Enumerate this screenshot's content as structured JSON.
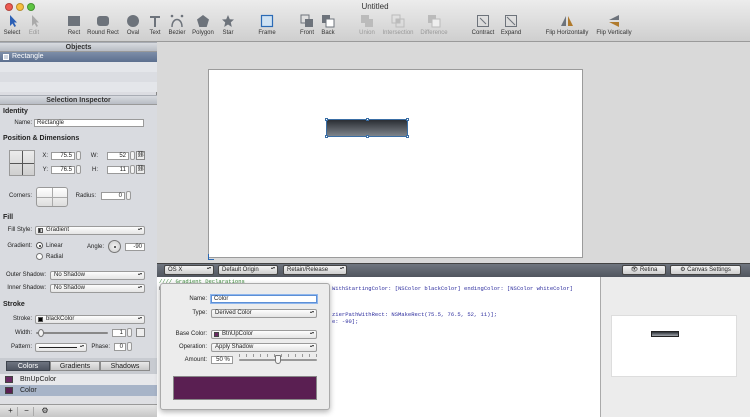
{
  "window": {
    "title": "Untitled"
  },
  "toolbar": [
    {
      "label": "Select",
      "icon": "arrow-cursor-icon",
      "enabled": true
    },
    {
      "label": "Edit",
      "icon": "edit-cursor-icon",
      "enabled": false
    },
    {
      "label": "Rect",
      "icon": "rect-icon",
      "enabled": true
    },
    {
      "label": "Round Rect",
      "icon": "round-rect-icon",
      "enabled": true
    },
    {
      "label": "Oval",
      "icon": "oval-icon",
      "enabled": true
    },
    {
      "label": "Text",
      "icon": "text-icon",
      "enabled": true
    },
    {
      "label": "Bezier",
      "icon": "bezier-icon",
      "enabled": true
    },
    {
      "label": "Polygon",
      "icon": "polygon-icon",
      "enabled": true
    },
    {
      "label": "Star",
      "icon": "star-icon",
      "enabled": true
    },
    {
      "label": "Frame",
      "icon": "frame-icon",
      "enabled": true
    },
    {
      "label": "Front",
      "icon": "front-icon",
      "enabled": true
    },
    {
      "label": "Back",
      "icon": "back-icon",
      "enabled": true
    },
    {
      "label": "Union",
      "icon": "union-icon",
      "enabled": false
    },
    {
      "label": "Intersection",
      "icon": "intersection-icon",
      "enabled": false
    },
    {
      "label": "Difference",
      "icon": "difference-icon",
      "enabled": false
    },
    {
      "label": "Contract",
      "icon": "contract-icon",
      "enabled": true
    },
    {
      "label": "Expand",
      "icon": "expand-icon",
      "enabled": true
    },
    {
      "label": "Flip Horizontally",
      "icon": "flip-horizontal-icon",
      "enabled": true
    },
    {
      "label": "Flip Vertically",
      "icon": "flip-vertical-icon",
      "enabled": true
    }
  ],
  "objects": {
    "header": "Objects",
    "items": [
      "Rectangle"
    ]
  },
  "inspector": {
    "header": "Selection Inspector",
    "identity": {
      "title": "Identity",
      "name_label": "Name:",
      "name_value": "Rectangle"
    },
    "position": {
      "title": "Position & Dimensions",
      "x_label": "X:",
      "x": "75.5",
      "y_label": "Y:",
      "y": "76.5",
      "w_label": "W:",
      "w": "52",
      "h_label": "H:",
      "h": "11"
    },
    "corners": {
      "label": "Corners:",
      "radius_label": "Radius:",
      "radius": "0"
    },
    "fill": {
      "title": "Fill",
      "style_label": "Fill Style:",
      "style": "Gradient",
      "gradient_label": "Gradient:",
      "linear": "Linear",
      "radial": "Radial",
      "angle_label": "Angle:",
      "angle": "-90"
    },
    "shadows": {
      "outer_label": "Outer Shadow:",
      "outer": "No Shadow",
      "inner_label": "Inner Shadow:",
      "inner": "No Shadow"
    },
    "stroke": {
      "title": "Stroke",
      "stroke_label": "Stroke:",
      "stroke": "blackColor",
      "width_label": "Width:",
      "width": "1",
      "pattern_label": "Pattern:",
      "phase_label": "Phase:",
      "phase": "0"
    }
  },
  "library": {
    "tabs": [
      "Colors",
      "Gradients",
      "Shadows"
    ],
    "active_tab": "Colors",
    "items": [
      {
        "name": "BtnUpColor",
        "color": "#6a2a63"
      },
      {
        "name": "Color",
        "color": "#5a1f52"
      }
    ]
  },
  "bottom_buttons": [
    "+",
    "−",
    "⚙"
  ],
  "codebar": {
    "os": "OS X",
    "origin": "Default Origin",
    "memory": "Retain/Release",
    "retina": "Retina",
    "canvas_settings": "Canvas Settings"
  },
  "code_lines": [
    {
      "gutter": "////",
      "text": " Gradient Declarations"
    },
    {
      "gutter": "N",
      "text": "WithStartingColor: [NSColor blackColor] endingColor: [NSColor whiteColor]"
    },
    {
      "gutter": "",
      "text": "zierPathWithRect: NSMakeRect(75.5, 76.5, 52, 11)];"
    },
    {
      "gutter": "",
      "text": "e: -90];"
    }
  ],
  "popover": {
    "name_label": "Name:",
    "name": "Color",
    "type_label": "Type:",
    "type": "Derived Color",
    "base_label": "Base Color:",
    "base": "BtnUpColor",
    "operation_label": "Operation:",
    "operation": "Apply Shadow",
    "amount_label": "Amount:",
    "amount": "50 %",
    "swatch": "#5a1f52"
  },
  "colors": {
    "accent": "#3a6ea5",
    "swatch_primary": "#6a2a63"
  }
}
